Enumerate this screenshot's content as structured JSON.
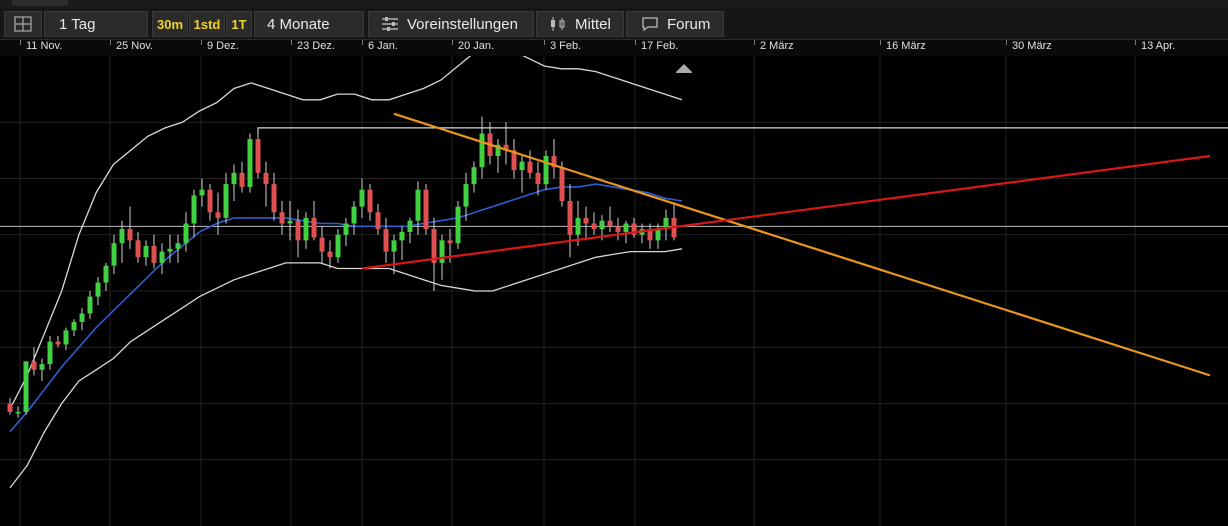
{
  "toolbar": {
    "interval_label": "1 Tag",
    "btn_30m": "30m",
    "btn_1std": "1std",
    "btn_1t": "1T",
    "range_label": "4 Monate",
    "presets_label": "Voreinstellungen",
    "average_label": "Mittel",
    "forum_label": "Forum",
    "icons": [
      "grid-layout-icon",
      "sliders-icon",
      "candles-icon",
      "chat-bubble-icon"
    ]
  },
  "chart_data": {
    "type": "candlestick",
    "x_ticks": [
      "11 Nov.",
      "25 Nov.",
      "9 Dez.",
      "23 Dez.",
      "6 Jan.",
      "20 Jan.",
      "3 Feb.",
      "17 Feb.",
      "2 März",
      "16 März",
      "30 März",
      "13 Apr."
    ],
    "colors": {
      "up": "#3fd13f",
      "down": "#e05050",
      "bollinger": "#d8d8d8",
      "average": "#2d5fd0",
      "trend_down": "#e8961e",
      "trend_up": "#d81818",
      "background": "#000000"
    },
    "candles": [
      [
        100,
        102,
        96,
        97
      ],
      [
        97,
        99,
        95,
        97
      ],
      [
        97,
        115,
        96,
        115
      ],
      [
        115,
        120,
        110,
        112
      ],
      [
        112,
        116,
        108,
        114
      ],
      [
        114,
        124,
        112,
        122
      ],
      [
        122,
        124,
        120,
        121
      ],
      [
        121,
        127,
        119,
        126
      ],
      [
        126,
        130,
        124,
        129
      ],
      [
        129,
        134,
        126,
        132
      ],
      [
        132,
        140,
        130,
        138
      ],
      [
        138,
        145,
        135,
        143
      ],
      [
        143,
        150,
        140,
        149
      ],
      [
        149,
        160,
        146,
        157
      ],
      [
        157,
        165,
        150,
        162
      ],
      [
        162,
        170,
        155,
        158
      ],
      [
        158,
        161,
        150,
        152
      ],
      [
        152,
        158,
        149,
        156
      ],
      [
        156,
        160,
        148,
        150
      ],
      [
        150,
        157,
        146,
        154
      ],
      [
        154,
        160,
        150,
        155
      ],
      [
        155,
        160,
        150,
        157
      ],
      [
        157,
        168,
        154,
        164
      ],
      [
        164,
        176,
        159,
        174
      ],
      [
        174,
        180,
        170,
        176
      ],
      [
        176,
        178,
        165,
        168
      ],
      [
        168,
        175,
        160,
        166
      ],
      [
        166,
        182,
        164,
        178
      ],
      [
        178,
        185,
        172,
        182
      ],
      [
        182,
        186,
        175,
        177
      ],
      [
        177,
        196,
        175,
        194
      ],
      [
        194,
        198,
        180,
        182
      ],
      [
        182,
        186,
        170,
        178
      ],
      [
        178,
        182,
        165,
        168
      ],
      [
        168,
        172,
        160,
        164
      ],
      [
        164,
        172,
        158,
        165
      ],
      [
        165,
        169,
        152,
        158
      ],
      [
        158,
        168,
        155,
        166
      ],
      [
        166,
        172,
        158,
        159
      ],
      [
        159,
        163,
        150,
        154
      ],
      [
        154,
        158,
        148,
        152
      ],
      [
        152,
        162,
        150,
        160
      ],
      [
        160,
        166,
        156,
        164
      ],
      [
        164,
        172,
        160,
        170
      ],
      [
        170,
        180,
        166,
        176
      ],
      [
        176,
        178,
        165,
        168
      ],
      [
        168,
        171,
        160,
        162
      ],
      [
        162,
        166,
        150,
        154
      ],
      [
        154,
        160,
        146,
        158
      ],
      [
        158,
        163,
        151,
        161
      ],
      [
        161,
        166,
        157,
        165
      ],
      [
        165,
        179,
        160,
        176
      ],
      [
        176,
        178,
        160,
        162
      ],
      [
        162,
        166,
        140,
        150
      ],
      [
        150,
        160,
        144,
        158
      ],
      [
        158,
        162,
        150,
        157
      ],
      [
        157,
        172,
        155,
        170
      ],
      [
        170,
        182,
        165,
        178
      ],
      [
        178,
        186,
        175,
        184
      ],
      [
        184,
        202,
        180,
        196
      ],
      [
        196,
        200,
        185,
        188
      ],
      [
        188,
        194,
        182,
        192
      ],
      [
        192,
        200,
        185,
        190
      ],
      [
        190,
        194,
        180,
        183
      ],
      [
        183,
        188,
        175,
        186
      ],
      [
        186,
        190,
        180,
        182
      ],
      [
        182,
        186,
        174,
        178
      ],
      [
        178,
        190,
        176,
        188
      ],
      [
        188,
        194,
        180,
        184
      ],
      [
        184,
        186,
        170,
        172
      ],
      [
        172,
        178,
        152,
        160
      ],
      [
        160,
        172,
        156,
        166
      ],
      [
        166,
        170,
        158,
        164
      ],
      [
        164,
        168,
        160,
        162
      ],
      [
        162,
        167,
        158,
        165
      ],
      [
        165,
        170,
        161,
        163
      ],
      [
        163,
        166,
        158,
        161
      ],
      [
        161,
        165,
        157,
        164
      ],
      [
        164,
        166,
        159,
        160
      ],
      [
        160,
        164,
        157,
        162
      ],
      [
        162,
        164,
        155,
        158
      ],
      [
        158,
        164,
        155,
        162
      ],
      [
        162,
        169,
        158,
        166
      ],
      [
        166,
        171,
        158,
        159
      ]
    ],
    "lines": {
      "moving_average": [
        90,
        97,
        105,
        113,
        120,
        127,
        133,
        139,
        145,
        151,
        156,
        161,
        164,
        166,
        166,
        166,
        166,
        165,
        164,
        164,
        163,
        163,
        163,
        163,
        164,
        165,
        166,
        168,
        170,
        172,
        174,
        176,
        177,
        177,
        178,
        177,
        176,
        175,
        173,
        172
      ],
      "bollinger_upper": [
        98,
        110,
        125,
        140,
        160,
        175,
        185,
        190,
        195,
        198,
        200,
        204,
        207,
        212,
        214,
        212,
        210,
        208,
        208,
        210,
        210,
        208,
        208,
        210,
        212,
        215,
        220,
        225,
        228,
        226,
        223,
        220,
        219,
        219,
        218,
        216,
        214,
        212,
        210,
        208
      ],
      "bollinger_lower": [
        70,
        78,
        90,
        100,
        108,
        112,
        116,
        122,
        126,
        130,
        134,
        138,
        141,
        144,
        146,
        148,
        150,
        150,
        150,
        148,
        148,
        148,
        148,
        146,
        144,
        142,
        141,
        140,
        140,
        142,
        144,
        146,
        148,
        150,
        152,
        153,
        154,
        154,
        154,
        155
      ]
    },
    "levels": {
      "horizontal_top": 198,
      "horizontal_mid": 163
    },
    "trendlines": {
      "down": {
        "from": [
          48,
          203
        ],
        "to": [
          150,
          110
        ]
      },
      "up": {
        "from": [
          44,
          148
        ],
        "to": [
          150,
          188
        ]
      }
    },
    "grid": true
  }
}
